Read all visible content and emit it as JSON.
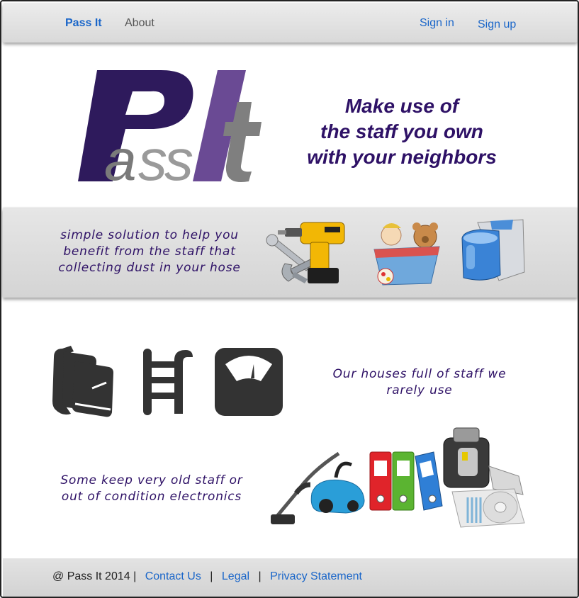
{
  "nav": {
    "brand": "Pass It",
    "about": "About",
    "sign_in": "Sign in",
    "sign_up": "Sign up"
  },
  "hero": {
    "logo_text": "PassIt",
    "tagline": [
      "Make use of",
      "the staff you own",
      "with your neighbors"
    ]
  },
  "band": {
    "text": [
      "simple solution to help you",
      "benefit from the staff that",
      "collecting dust in your hose"
    ],
    "images": [
      "tools-icon",
      "toy-box-icon",
      "blender-icon"
    ]
  },
  "features": {
    "icons": [
      "books-icon",
      "ladder-icon",
      "scale-icon"
    ],
    "houses_text": [
      "Our houses full of staff we",
      "rarely use"
    ],
    "old_text": [
      "Some keep very old staff or",
      "out of condition electronics"
    ],
    "images": [
      "vacuum-cleaner-icon",
      "binders-icon",
      "cd-shredder-icon"
    ]
  },
  "footer": {
    "copyright": "@ Pass It  2014 |",
    "contact": "Contact Us",
    "legal": "Legal",
    "privacy": "Privacy Statement",
    "separator": "|"
  },
  "colors": {
    "accent": "#1a66c9",
    "tagline": "#2e1166",
    "logo_dark": "#2e1a5c",
    "logo_light": "#6a4a94",
    "logo_gray": "#7a7a7a"
  }
}
